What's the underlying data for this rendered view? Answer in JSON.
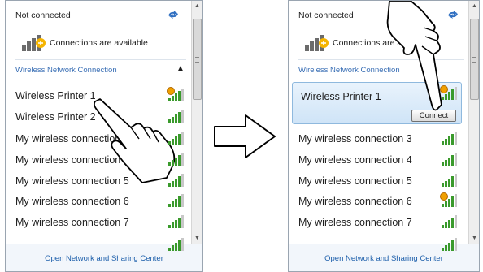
{
  "left_panel": {
    "status": "Not connected",
    "availability": "Connections are available",
    "section_header": "Wireless Network Connection",
    "networks": [
      {
        "name": "Wireless Printer 1",
        "secured": true
      },
      {
        "name": "Wireless Printer 2",
        "secured": false
      },
      {
        "name": "My wireless connection 3",
        "secured": false
      },
      {
        "name": "My wireless connection 4",
        "secured": false
      },
      {
        "name": "My wireless connection 5",
        "secured": false
      },
      {
        "name": "My wireless connection 6",
        "secured": false
      },
      {
        "name": "My wireless connection 7",
        "secured": false
      }
    ],
    "footer_link": "Open Network and Sharing Center"
  },
  "right_panel": {
    "status": "Not connected",
    "availability": "Connections are available",
    "section_header": "Wireless Network Connection",
    "selected_network": "Wireless Printer 1",
    "connect_button": "Connect",
    "networks": [
      {
        "name": "My wireless connection 3",
        "secured": false
      },
      {
        "name": "My wireless connection 4",
        "secured": false
      },
      {
        "name": "My wireless connection 5",
        "secured": false
      },
      {
        "name": "My wireless connection 6",
        "secured": true
      },
      {
        "name": "My wireless connection 7",
        "secured": false
      }
    ],
    "footer_link": "Open Network and Sharing Center"
  },
  "icons": {
    "refresh": "refresh-icon",
    "availability": "network-available-icon",
    "signal": "signal-strength-icon",
    "pointer": "pointing-hand-icon",
    "transition": "right-arrow-icon"
  },
  "colors": {
    "signal_green": "#3a9a2c",
    "signal_grey": "#c8c8c8",
    "link_blue": "#1d5fab",
    "header_blue": "#3a6fb5",
    "selection": "#cfe4f7"
  }
}
